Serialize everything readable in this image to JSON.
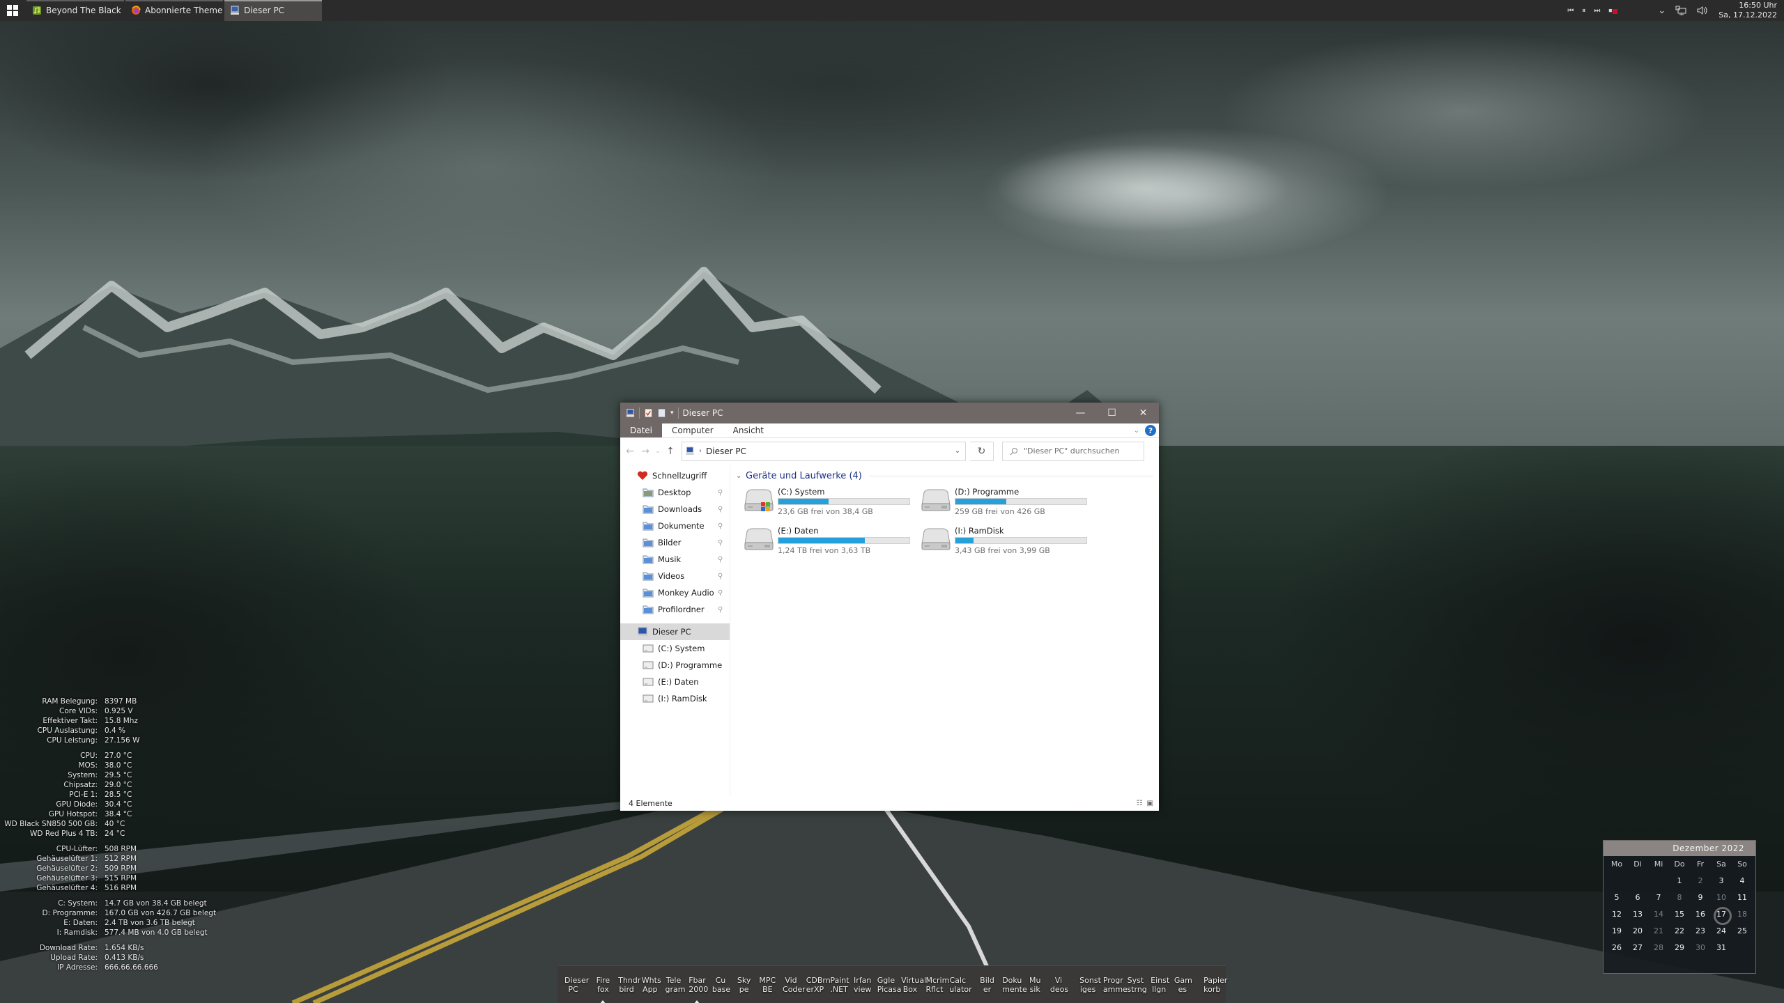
{
  "taskbar": {
    "start_label": "Start",
    "tasks": [
      {
        "label": "Beyond The Black - My ...",
        "icon": "music-note-icon",
        "active": false
      },
      {
        "label": "Abonnierte Themen | H...",
        "icon": "firefox-icon",
        "active": false
      },
      {
        "label": "Dieser PC",
        "icon": "computer-icon",
        "active": true
      }
    ],
    "media": {
      "prev": "⏮",
      "pause": "⏸",
      "next": "⏭",
      "stop": "⏹"
    },
    "tray_icons": [
      "chevron-up-icon",
      "network-icon",
      "volume-icon"
    ],
    "clock": {
      "time": "16:50 Uhr",
      "date": "Sa, 17.12.2022"
    }
  },
  "explorer": {
    "title": "Dieser PC",
    "window_controls": {
      "minimize": "—",
      "maximize": "☐",
      "close": "✕"
    },
    "ribbon_tabs": [
      "Datei",
      "Computer",
      "Ansicht"
    ],
    "help_label": "?",
    "address": {
      "crumb": "Dieser PC"
    },
    "search_placeholder": "\"Dieser PC\" durchsuchen",
    "nav": {
      "quick_access": "Schnellzugriff",
      "pinned": [
        "Desktop",
        "Downloads",
        "Dokumente",
        "Bilder",
        "Musik",
        "Videos",
        "Monkey Audio",
        "Profilordner"
      ],
      "this_pc": "Dieser PC",
      "drives": [
        "(C:) System",
        "(D:) Programme",
        "(E:) Daten",
        "(I:) RamDisk"
      ]
    },
    "group_header": "Geräte und Laufwerke (4)",
    "drives": [
      {
        "name": "(C:) System",
        "free_text": "23,6 GB frei von 38,4 GB",
        "used_fraction": 0.385
      },
      {
        "name": "(D:) Programme",
        "free_text": "259 GB frei von 426 GB",
        "used_fraction": 0.39
      },
      {
        "name": "(E:) Daten",
        "free_text": "1,24 TB frei von 3,63 TB",
        "used_fraction": 0.66
      },
      {
        "name": "(I:) RamDisk",
        "free_text": "3,43 GB frei von 3,99 GB",
        "used_fraction": 0.14
      }
    ],
    "status": "4 Elemente"
  },
  "sysmon": {
    "groups": [
      [
        {
          "label": "RAM Belegung:",
          "value": "8397 MB"
        },
        {
          "label": "Core VIDs:",
          "value": "0.925 V"
        },
        {
          "label": "Effektiver Takt:",
          "value": "15.8 Mhz"
        },
        {
          "label": "CPU Auslastung:",
          "value": "0.4 %"
        },
        {
          "label": "CPU Leistung:",
          "value": "27.156 W"
        }
      ],
      [
        {
          "label": "CPU:",
          "value": "27.0 °C"
        },
        {
          "label": "MOS:",
          "value": "38.0 °C"
        },
        {
          "label": "System:",
          "value": "29.5 °C"
        },
        {
          "label": "Chipsatz:",
          "value": "29.0 °C"
        },
        {
          "label": "PCI-E 1:",
          "value": "28.5 °C"
        },
        {
          "label": "GPU Diode:",
          "value": "30.4 °C"
        },
        {
          "label": "GPU Hotspot:",
          "value": "38.4 °C"
        },
        {
          "label": "WD Black SN850 500 GB:",
          "value": "40 °C"
        },
        {
          "label": "WD Red Plus 4 TB:",
          "value": "24 °C"
        }
      ],
      [
        {
          "label": "CPU-Lüfter:",
          "value": "508 RPM"
        },
        {
          "label": "Gehäuselüfter 1:",
          "value": "512 RPM"
        },
        {
          "label": "Gehäuselüfter 2:",
          "value": "509 RPM"
        },
        {
          "label": "Gehäuselüfter 3:",
          "value": "515 RPM"
        },
        {
          "label": "Gehäuselüfter 4:",
          "value": "516 RPM"
        }
      ],
      [
        {
          "label": "C: System:",
          "value": "14.7 GB von 38.4 GB belegt"
        },
        {
          "label": "D: Programme:",
          "value": "167.0 GB von 426.7 GB belegt"
        },
        {
          "label": "E: Daten:",
          "value": "2.4 TB von 3.6 TB belegt"
        },
        {
          "label": "I: Ramdisk:",
          "value": "577.4 MB von 4.0 GB belegt"
        }
      ],
      [
        {
          "label": "Download Rate:",
          "value": "1.654 KB/s"
        },
        {
          "label": "Upload Rate:",
          "value": "0.413 KB/s"
        },
        {
          "label": "IP Adresse:",
          "value": "666.66.66.666"
        }
      ]
    ]
  },
  "calendar": {
    "header": "Dezember 2022",
    "weekdays": [
      "Mo",
      "Di",
      "Mi",
      "Do",
      "Fr",
      "Sa",
      "So"
    ],
    "leading_blanks": 3,
    "days": 31,
    "today": 17,
    "dim_days": [
      2,
      8,
      10,
      14,
      18,
      21,
      28,
      30
    ]
  },
  "dock": {
    "items": [
      {
        "label": "Dieser\nPC",
        "running": false,
        "gap_after": "l"
      },
      {
        "label": "Fire\nfox",
        "running": true
      },
      {
        "label": "Thndr\nbird"
      },
      {
        "label": "Whts\nApp"
      },
      {
        "label": "Tele\ngram"
      },
      {
        "label": "Fbar\n2000",
        "running": true
      },
      {
        "label": "Cu\nbase"
      },
      {
        "label": "Sky\npe"
      },
      {
        "label": "MPC\nBE"
      },
      {
        "label": "Vid\nCoder"
      },
      {
        "label": "CDBrn\nerXP"
      },
      {
        "label": "Paint\n.NET"
      },
      {
        "label": "Irfan\nview"
      },
      {
        "label": "Ggle\nPicasa"
      },
      {
        "label": "Virtual\nBox"
      },
      {
        "label": "Mcrim\nRflct"
      },
      {
        "label": "Calc\nulator",
        "gap_after": "l"
      },
      {
        "label": "Bild\ner"
      },
      {
        "label": "Doku\nmente"
      },
      {
        "label": "Mu\nsik"
      },
      {
        "label": "Vi\ndeos",
        "gap_after": "l"
      },
      {
        "label": "Sonst\niges"
      },
      {
        "label": "Progr\namme"
      },
      {
        "label": "Syst\nstrng"
      },
      {
        "label": "Einst\nllgn"
      },
      {
        "label": "Gam\nes",
        "gap_after": "l"
      },
      {
        "label": "Papier\nkorb"
      }
    ]
  }
}
